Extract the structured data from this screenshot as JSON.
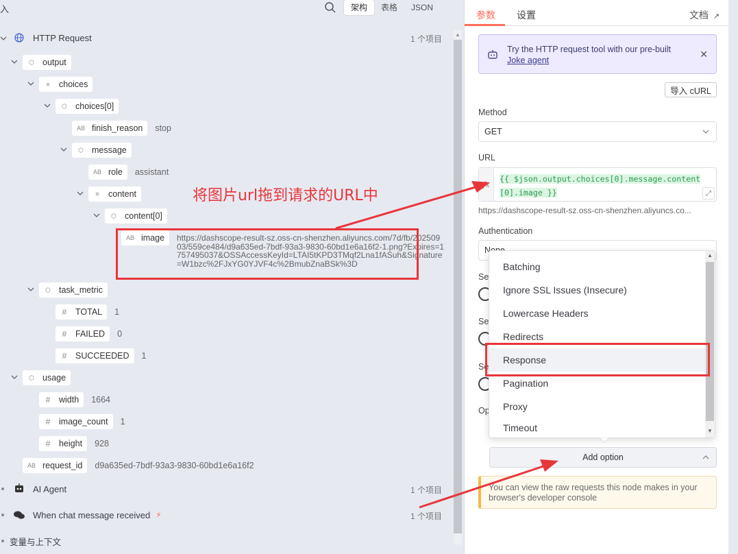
{
  "left": {
    "title_fragment": "入",
    "view_tabs": [
      "架构",
      "表格",
      "JSON"
    ],
    "active_view": "架构",
    "tree": {
      "http_request": {
        "label": "HTTP Request",
        "count": "1 个项目"
      },
      "output": "output",
      "choices": "choices",
      "choices0": "choices[0]",
      "finish_reason": {
        "key": "finish_reason",
        "value": "stop"
      },
      "message": "message",
      "role": {
        "key": "role",
        "value": "assistant"
      },
      "content": "content",
      "content0": "content[0]",
      "image": {
        "key": "image",
        "value": "https://dashscope-result-sz.oss-cn-shenzhen.aliyuncs.com/7d/fb/20250903/559ce484/d9a635ed-7bdf-93a3-9830-60bd1e6a16f2-1.png?Expires=1757495037&OSSAccessKeyId=LTAI5tKPD3TMqf2Lna1fASuh&Signature=W1bzc%2FJxYG0YJVF4c%2BmubZnaBSk%3D"
      },
      "task_metric": "task_metric",
      "total": {
        "key": "TOTAL",
        "value": "1"
      },
      "failed": {
        "key": "FAILED",
        "value": "0"
      },
      "succeeded": {
        "key": "SUCCEEDED",
        "value": "1"
      },
      "usage": "usage",
      "width": {
        "key": "width",
        "value": "1664"
      },
      "image_count": {
        "key": "image_count",
        "value": "1"
      },
      "height": {
        "key": "height",
        "value": "928"
      },
      "request_id": {
        "key": "request_id",
        "value": "d9a635ed-7bdf-93a3-9830-60bd1e6a16f2"
      },
      "ai_agent": {
        "label": "AI Agent",
        "count": "1 个项目"
      },
      "chat_trigger": {
        "label": "When chat message received",
        "count": "1 个项目"
      },
      "variables": "变量与上下文"
    }
  },
  "annotation": {
    "text": "将图片url拖到请求的URL中",
    "color": "#e8353a"
  },
  "right": {
    "tabs": {
      "params": "参数",
      "settings": "设置",
      "docs": "文档"
    },
    "banner": {
      "text": "Try the HTTP request tool with our pre-built",
      "link": "Joke agent"
    },
    "import_curl": "导入 cURL",
    "method": {
      "label": "Method",
      "value": "GET"
    },
    "url": {
      "label": "URL",
      "expression_line1": "{{ $json.output.choices[0].message.content",
      "expression_line2": "[0].image }}",
      "preview": "https://dashscope-result-sz.oss-cn-shenzhen.aliyuncs.co..."
    },
    "authentication": {
      "label": "Authentication",
      "value_fragment": "None"
    },
    "partial_labels": [
      "Se",
      "Se",
      "Se",
      "Op"
    ],
    "dropdown": {
      "items": [
        "Batching",
        "Ignore SSL Issues (Insecure)",
        "Lowercase Headers",
        "Redirects",
        "Response",
        "Pagination",
        "Proxy",
        "Timeout"
      ],
      "highlighted": "Response"
    },
    "add_option": "Add option",
    "hint": "You can view the raw requests this node makes in your browser's developer console"
  },
  "colors": {
    "accent": "#ff6d5a",
    "annotation": "#e8353a",
    "expr_green": "#2d9c52"
  }
}
